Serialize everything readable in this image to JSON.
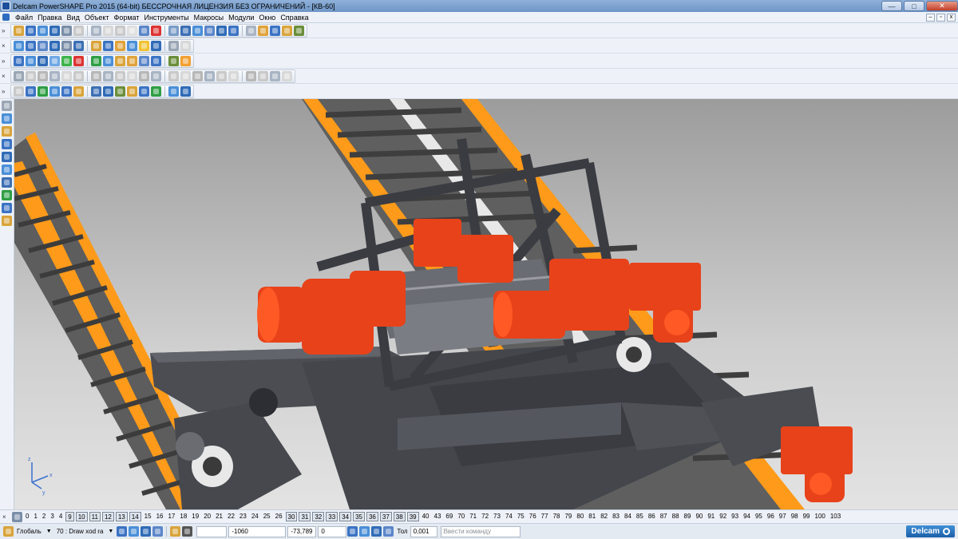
{
  "title": "Delcam PowerSHAPE Pro 2015 (64-bit) БЕССРОЧНАЯ ЛИЦЕНЗИЯ БЕЗ ОГРАНИЧЕНИЙ - [КВ-60]",
  "window_buttons": {
    "minimize": "—",
    "maximize": "□",
    "close": "✕"
  },
  "menu": [
    "Файл",
    "Правка",
    "Вид",
    "Объект",
    "Формат",
    "Инструменты",
    "Макросы",
    "Модули",
    "Окно",
    "Справка"
  ],
  "mdi_buttons": {
    "minimize": "–",
    "restore": "▫",
    "close": "x"
  },
  "toolbars": {
    "row1": {
      "close": "»",
      "colors": [
        "#d9a43b",
        "#3b73c4",
        "#4a8fd8",
        "#2f6bb7",
        "#7b8ea8",
        "#c9c9c9",
        "#a8b4c4",
        "#d8d8d8",
        "#c9c9c9",
        "#e0e0e0",
        "#5b86c9",
        "#d33",
        "#7a9cc8",
        "#3c6fb4",
        "#4a8fd8",
        "#5b86c9",
        "#2f6bb7",
        "#3b73c4",
        "#a8b4c4",
        "#e0a23a",
        "#3b73c4",
        "#d9a43b",
        "#6b8e3a"
      ]
    },
    "row2": {
      "close": "×",
      "colors": [
        "#4a8fd8",
        "#3b73c4",
        "#5b86c9",
        "#2f6bb7",
        "#7b8ea8",
        "#3c6fb4",
        "#d9a43b",
        "#3b73c4",
        "#e0a23a",
        "#4a8fd8",
        "#f2c232",
        "#2f6bb7",
        "#9aa6b4",
        "#d8d8d8"
      ]
    },
    "row3": {
      "close": "»",
      "colors": [
        "#3b73c4",
        "#4a8fd8",
        "#2f6bb7",
        "#6fa8e6",
        "#3cb34a",
        "#d33",
        "#2f9e44",
        "#4a8fd8",
        "#d9a43b",
        "#e0a23a",
        "#5b86c9",
        "#3b73c4",
        "#6b8e3a",
        "#f2a032"
      ]
    },
    "row4": {
      "close": "×",
      "colors": [
        "#9aa6b4",
        "#c9c9c9",
        "#b7b7b7",
        "#a8b4c4",
        "#d8d8d8",
        "#c9c9c9",
        "#b7b7b7",
        "#a8b4c4",
        "#c9c9c9",
        "#d8d8d8",
        "#b7b7b7",
        "#a8b4c4",
        "#c9c9c9",
        "#d8d8d8",
        "#b7b7b7",
        "#a8b4c4",
        "#c9c9c9",
        "#d8d8d8",
        "#b7b7b7",
        "#c9c9c9",
        "#a8b4c4",
        "#d8d8d8"
      ]
    },
    "row5": {
      "close": "»",
      "colors": [
        "#c9c9c9",
        "#3b73c4",
        "#2f9e44",
        "#4a8fd8",
        "#3b73c4",
        "#d9a43b",
        "#3c6fb4",
        "#2f6bb7",
        "#6b8e3a",
        "#d9a43b",
        "#3b73c4",
        "#2f9e44",
        "#4a8fd8",
        "#2f6bb7"
      ]
    }
  },
  "left_toolbar": {
    "colors": [
      "#9aa6b4",
      "#4a8fd8",
      "#d9a43b",
      "#3b73c4",
      "#2f6bb7",
      "#4a8fd8",
      "#3c6fb4",
      "#2f9e44",
      "#3b73c4",
      "#d9a43b"
    ]
  },
  "viewport": {
    "colors": {
      "orange": "#ff9a1a",
      "machine_gray": "#4a4c52",
      "motor_red": "#e8421a",
      "rail": "#5b5b5b"
    },
    "axis_labels": {
      "x": "x",
      "y": "y",
      "z": "z"
    }
  },
  "levels": [
    "0",
    "1",
    "2",
    "3",
    "4",
    "9",
    "10",
    "11",
    "12",
    "13",
    "14",
    "15",
    "16",
    "17",
    "18",
    "19",
    "20",
    "21",
    "22",
    "23",
    "24",
    "25",
    "26",
    "30",
    "31",
    "32",
    "33",
    "34",
    "35",
    "36",
    "37",
    "38",
    "39",
    "40",
    "43",
    "69",
    "70",
    "71",
    "72",
    "73",
    "74",
    "75",
    "76",
    "77",
    "78",
    "79",
    "80",
    "81",
    "82",
    "83",
    "84",
    "85",
    "86",
    "87",
    "88",
    "89",
    "90",
    "91",
    "92",
    "93",
    "94",
    "95",
    "96",
    "97",
    "98",
    "99",
    "100",
    "103"
  ],
  "levels_boxed": [
    "9",
    "10",
    "11",
    "12",
    "13",
    "14",
    "30",
    "31",
    "32",
    "33",
    "34",
    "35",
    "36",
    "37",
    "38",
    "39"
  ],
  "status": {
    "workplane": "Глобаль",
    "level": "70 : Draw xod ra",
    "x": "-1060",
    "y": "-73,789",
    "z": "0",
    "tol_label": "Тол",
    "tol": "0,001",
    "command_placeholder": "Ввести команду",
    "brand": "Delcam"
  }
}
